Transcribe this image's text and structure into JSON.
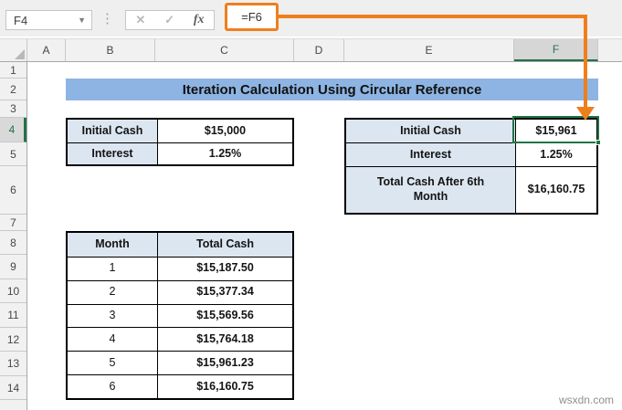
{
  "toolbar": {
    "name_box": "F4",
    "cancel_icon": "✕",
    "enter_icon": "✓",
    "fx_icon": "fx",
    "formula": "=F6"
  },
  "grid": {
    "columns": [
      {
        "label": "A"
      },
      {
        "label": "B"
      },
      {
        "label": "C"
      },
      {
        "label": "D"
      },
      {
        "label": "E"
      },
      {
        "label": "F"
      }
    ],
    "selected_column": "F",
    "row_numbers": [
      "1",
      "2",
      "3",
      "4",
      "5",
      "6",
      "7",
      "8",
      "9",
      "10",
      "11",
      "12",
      "13",
      "14"
    ],
    "selected_row": "4",
    "selected_cell": "F4"
  },
  "banner": {
    "title": "Iteration Calculation Using Circular Reference"
  },
  "tables": {
    "initial": {
      "rows": [
        {
          "label": "Initial Cash",
          "value": "$15,000"
        },
        {
          "label": "Interest",
          "value": "1.25%"
        }
      ]
    },
    "iterated": {
      "rows": [
        {
          "label": "Initial Cash",
          "value": "$15,961"
        },
        {
          "label": "Interest",
          "value": "1.25%"
        },
        {
          "label": "Total Cash After 6th Month",
          "value": "$16,160.75"
        }
      ]
    },
    "months": {
      "headers": {
        "month": "Month",
        "total": "Total Cash"
      },
      "rows": [
        {
          "month": "1",
          "total": "$15,187.50"
        },
        {
          "month": "2",
          "total": "$15,377.34"
        },
        {
          "month": "3",
          "total": "$15,569.56"
        },
        {
          "month": "4",
          "total": "$15,764.18"
        },
        {
          "month": "5",
          "total": "$15,961.23"
        },
        {
          "month": "6",
          "total": "$16,160.75"
        }
      ]
    }
  },
  "watermark": "wsxdn.com",
  "colors": {
    "accent_orange": "#ee7f1d",
    "selection_green": "#217346",
    "banner_blue": "#8db4e2",
    "label_blue": "#dce6f1"
  }
}
